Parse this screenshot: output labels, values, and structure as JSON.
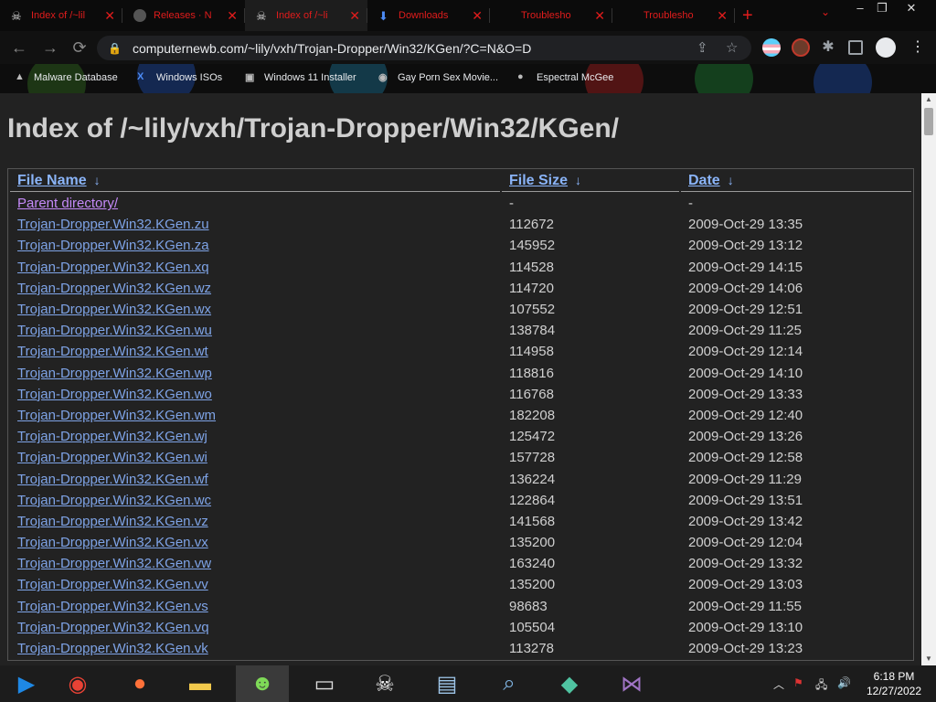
{
  "browser": {
    "tabs": [
      {
        "title": "Index of /~lil",
        "icon": "pirate-icon"
      },
      {
        "title": "Releases · N",
        "icon": "github-icon"
      },
      {
        "title": "Index of /~li",
        "icon": "pirate-icon",
        "active": true
      },
      {
        "title": "Downloads",
        "icon": "download-icon"
      },
      {
        "title": "Troublesho",
        "icon": "microsoft-icon"
      },
      {
        "title": "Troublesho",
        "icon": "microsoft-icon"
      }
    ],
    "tab_close_glyph": "✕",
    "new_tab_glyph": "+",
    "tab_search_glyph": "⌄",
    "window_controls": {
      "minimize": "–",
      "restore": "❐",
      "close": "✕"
    },
    "nav": {
      "back": "←",
      "forward": "→",
      "reload": "⟳"
    },
    "url": "computernewb.com/~lily/vxh/Trojan-Dropper/Win32/KGen/?C=N&O=D",
    "bookmarks": [
      {
        "label": "Malware Database",
        "icon": "app-icon"
      },
      {
        "label": "Windows ISOs",
        "icon": "x-icon"
      },
      {
        "label": "Windows 11 Installer",
        "icon": "window-icon"
      },
      {
        "label": "Gay Porn Sex Movie...",
        "icon": "globe-icon"
      },
      {
        "label": "Espectral McGee",
        "icon": "avatar-icon"
      }
    ]
  },
  "page": {
    "heading": "Index of /~lily/vxh/Trojan-Dropper/Win32/KGen/",
    "columns": [
      {
        "label": "File Name",
        "arrow": "↓"
      },
      {
        "label": "File Size",
        "arrow": "↓"
      },
      {
        "label": "Date",
        "arrow": "↓"
      }
    ],
    "parent": {
      "name": "Parent directory/",
      "size": "-",
      "date": "-"
    },
    "files": [
      {
        "name": "Trojan-Dropper.Win32.KGen.zu",
        "size": "112672",
        "date": "2009-Oct-29 13:35"
      },
      {
        "name": "Trojan-Dropper.Win32.KGen.za",
        "size": "145952",
        "date": "2009-Oct-29 13:12"
      },
      {
        "name": "Trojan-Dropper.Win32.KGen.xq",
        "size": "114528",
        "date": "2009-Oct-29 14:15"
      },
      {
        "name": "Trojan-Dropper.Win32.KGen.wz",
        "size": "114720",
        "date": "2009-Oct-29 14:06"
      },
      {
        "name": "Trojan-Dropper.Win32.KGen.wx",
        "size": "107552",
        "date": "2009-Oct-29 12:51"
      },
      {
        "name": "Trojan-Dropper.Win32.KGen.wu",
        "size": "138784",
        "date": "2009-Oct-29 11:25"
      },
      {
        "name": "Trojan-Dropper.Win32.KGen.wt",
        "size": "114958",
        "date": "2009-Oct-29 12:14"
      },
      {
        "name": "Trojan-Dropper.Win32.KGen.wp",
        "size": "118816",
        "date": "2009-Oct-29 14:10"
      },
      {
        "name": "Trojan-Dropper.Win32.KGen.wo",
        "size": "116768",
        "date": "2009-Oct-29 13:33"
      },
      {
        "name": "Trojan-Dropper.Win32.KGen.wm",
        "size": "182208",
        "date": "2009-Oct-29 12:40"
      },
      {
        "name": "Trojan-Dropper.Win32.KGen.wj",
        "size": "125472",
        "date": "2009-Oct-29 13:26"
      },
      {
        "name": "Trojan-Dropper.Win32.KGen.wi",
        "size": "157728",
        "date": "2009-Oct-29 12:58"
      },
      {
        "name": "Trojan-Dropper.Win32.KGen.wf",
        "size": "136224",
        "date": "2009-Oct-29 11:29"
      },
      {
        "name": "Trojan-Dropper.Win32.KGen.wc",
        "size": "122864",
        "date": "2009-Oct-29 13:51"
      },
      {
        "name": "Trojan-Dropper.Win32.KGen.vz",
        "size": "141568",
        "date": "2009-Oct-29 13:42"
      },
      {
        "name": "Trojan-Dropper.Win32.KGen.vx",
        "size": "135200",
        "date": "2009-Oct-29 12:04"
      },
      {
        "name": "Trojan-Dropper.Win32.KGen.vw",
        "size": "163240",
        "date": "2009-Oct-29 13:32"
      },
      {
        "name": "Trojan-Dropper.Win32.KGen.vv",
        "size": "135200",
        "date": "2009-Oct-29 13:03"
      },
      {
        "name": "Trojan-Dropper.Win32.KGen.vs",
        "size": "98683",
        "date": "2009-Oct-29 11:55"
      },
      {
        "name": "Trojan-Dropper.Win32.KGen.vq",
        "size": "105504",
        "date": "2009-Oct-29 13:10"
      },
      {
        "name": "Trojan-Dropper.Win32.KGen.vk",
        "size": "113278",
        "date": "2009-Oct-29 13:23"
      }
    ]
  },
  "taskbar": {
    "apps": [
      {
        "name": "windows-media-icon"
      },
      {
        "name": "chrome-icon"
      },
      {
        "name": "firefox-icon"
      },
      {
        "name": "file-explorer-icon"
      },
      {
        "name": "messenger-icon",
        "active": true
      },
      {
        "name": "command-prompt-icon"
      },
      {
        "name": "skull-icon"
      },
      {
        "name": "resource-monitor-icon"
      },
      {
        "name": "search-app-icon"
      },
      {
        "name": "cube-app-icon"
      },
      {
        "name": "visual-studio-icon"
      }
    ],
    "tray_glyphs": {
      "chevron": "︿",
      "network": "🖧",
      "volume": "🔊"
    },
    "time": "6:18 PM",
    "date": "12/27/2022"
  },
  "colors": {
    "tab_text": "#e11c1c",
    "link": "#7ea3e6",
    "visited": "#c58af9",
    "page_bg": "#222222"
  }
}
